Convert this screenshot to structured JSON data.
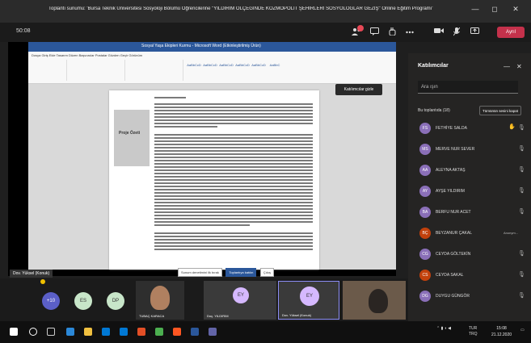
{
  "window": {
    "title": "Toplantı sunumu: 'Bursa Teknik Üniversitesi Sosyoloji Bölümü Öğrencilerine \"YILDIRIM ÖLÇEĞİNDE KOZMOPOLİT ŞEHİRLERİ SOSYOLOGLAR GEZİŞ\" Online Eğitim Programı'",
    "minimize_glyph": "—",
    "restore_glyph": "◻",
    "close_glyph": "✕"
  },
  "meeting_bar": {
    "timer": "50:08",
    "leave_label": "Ayrıl"
  },
  "shared_screen": {
    "doc_title": "Sosyal Yaşa Ekipleri Kurmu - Microsoft Word (Etkinleştirilmiş Ürün)",
    "ribbon_tabs": "Dosya  Giriş  Ekle  Tasarım  Düzen  Başvurular  Postalar  Gözden Geçir  Görünüm",
    "styles": [
      "AaBbCcD",
      "AaBbCcD",
      "AaBbCcD",
      "AaBbCcD",
      "AaBbCcD",
      "AaBbC"
    ],
    "tooltip": "Katılımcılar gizle",
    "side_label": "Proje Özeti",
    "footer_buttons": [
      "Sunum denetimini ilk bırak",
      "Toplantıya katılın",
      "Çıkış"
    ],
    "presenter_name": "Dov. Yüksel (Konuk)"
  },
  "panel": {
    "title": "Katılımcılar",
    "search_placeholder": "Ara ışın",
    "section": "Bu toplantıda (18)",
    "mute_all": "Tümünün sesini kapat",
    "participants": [
      {
        "initials": "FS",
        "name": "FETHİYE SALDA",
        "color": "#8a6fb8",
        "hand": true
      },
      {
        "initials": "MS",
        "name": "MERVE NUR SEVER",
        "color": "#8a6fb8",
        "hand": false
      },
      {
        "initials": "AA",
        "name": "ALEYNA AKTAŞ",
        "color": "#8a6fb8",
        "hand": false
      },
      {
        "initials": "AY",
        "name": "AYŞE YILDIRIM",
        "color": "#8a6fb8",
        "hand": false
      },
      {
        "initials": "BA",
        "name": "BERFU NUR ACET",
        "color": "#8a6fb8",
        "hand": false
      },
      {
        "initials": "BÇ",
        "name": "BEYZANUR ÇAKAL",
        "color": "#c2410c",
        "status": "Anonym...",
        "hand": false
      },
      {
        "initials": "CG",
        "name": "CEYDA GÖLTEKİN",
        "color": "#8a6fb8",
        "hand": false
      },
      {
        "initials": "CS",
        "name": "CEYDA SAKAL",
        "color": "#c2410c",
        "hand": false
      },
      {
        "initials": "DG",
        "name": "DUYGU GÜNGÖR",
        "color": "#8a6fb8",
        "hand": false
      }
    ]
  },
  "strip": {
    "extra_count": "+10",
    "bubbles": [
      "ES",
      "DP"
    ],
    "tiles": [
      {
        "name": "TUBAÇ KARACA",
        "initials": ""
      },
      {
        "name": "Doç. YILDIRIM",
        "initials": "EY"
      },
      {
        "name": "Dov. Yüksel (Konuk)",
        "initials": "EY"
      },
      {
        "name": "",
        "initials": ""
      }
    ]
  },
  "taskbar": {
    "time": "15:08",
    "date": "21.12.2020",
    "lang": "TUR",
    "lang2": "TRQ"
  }
}
